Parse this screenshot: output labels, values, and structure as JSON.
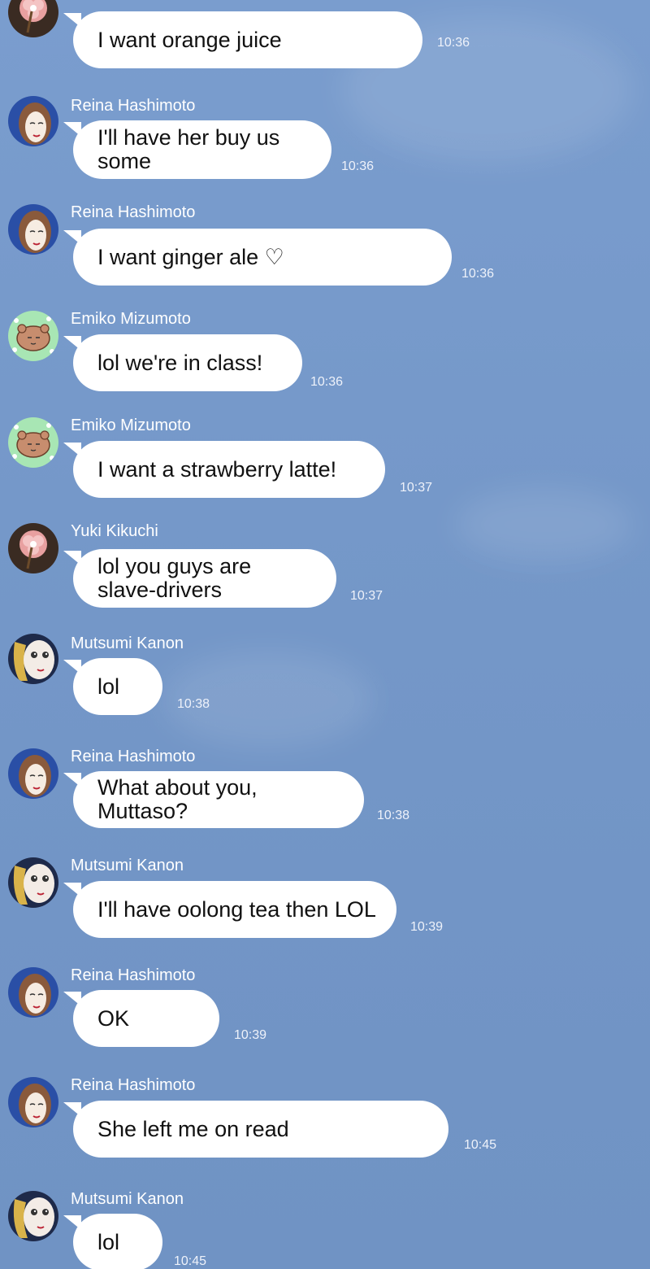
{
  "colors": {
    "background": "#7598c9",
    "bubble": "#ffffff",
    "bubble_text": "#111111",
    "sender_name": "#ffffff",
    "timestamp": "#eef2fa"
  },
  "messages": [
    {
      "sender": "",
      "avatar": "yuki-avatar-icon",
      "text": "I want orange juice",
      "time": "10:36"
    },
    {
      "sender": "Reina Hashimoto",
      "avatar": "reina-avatar-icon",
      "text": "I'll have her buy us\nsome",
      "time": "10:36"
    },
    {
      "sender": "Reina Hashimoto",
      "avatar": "reina-avatar-icon",
      "text": "I want ginger ale ♡",
      "time": "10:36"
    },
    {
      "sender": "Emiko Mizumoto",
      "avatar": "emiko-avatar-icon",
      "text": "lol we're in class!",
      "time": "10:36"
    },
    {
      "sender": "Emiko Mizumoto",
      "avatar": "emiko-avatar-icon",
      "text": "I want a strawberry latte!",
      "time": "10:37"
    },
    {
      "sender": "Yuki Kikuchi",
      "avatar": "yuki-avatar-icon",
      "text": "lol you guys are\nslave-drivers",
      "time": "10:37"
    },
    {
      "sender": "Mutsumi Kanon",
      "avatar": "mutsumi-avatar-icon",
      "text": "lol",
      "time": "10:38"
    },
    {
      "sender": "Reina Hashimoto",
      "avatar": "reina-avatar-icon",
      "text": "What about you, Muttaso?",
      "time": "10:38"
    },
    {
      "sender": "Mutsumi Kanon",
      "avatar": "mutsumi-avatar-icon",
      "text": "I'll have oolong tea then LOL",
      "time": "10:39"
    },
    {
      "sender": "Reina Hashimoto",
      "avatar": "reina-avatar-icon",
      "text": "OK",
      "time": "10:39"
    },
    {
      "sender": "Reina Hashimoto",
      "avatar": "reina-avatar-icon",
      "text": "She left me on read",
      "time": "10:45"
    },
    {
      "sender": "Mutsumi Kanon",
      "avatar": "mutsumi-avatar-icon",
      "text": "lol",
      "time": "10:45"
    }
  ]
}
